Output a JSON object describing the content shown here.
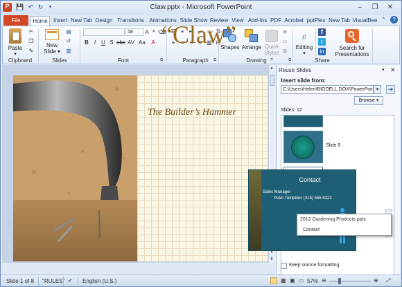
{
  "window": {
    "title": "Claw.pptx - Microsoft PowerPoint"
  },
  "qat": {
    "save_icon": "save-icon",
    "undo_icon": "undo-icon",
    "redo_icon": "redo-icon",
    "customize_icon": "chevron-down-icon"
  },
  "window_controls": {
    "minimize": "–",
    "restore": "❐",
    "close": "✕"
  },
  "tabs": [
    {
      "label": "File"
    },
    {
      "label": "Home"
    },
    {
      "label": "Insert"
    },
    {
      "label": "New Tab"
    },
    {
      "label": "Design"
    },
    {
      "label": "Transitions"
    },
    {
      "label": "Animations"
    },
    {
      "label": "Slide Show"
    },
    {
      "label": "Review"
    },
    {
      "label": "View"
    },
    {
      "label": "Add-Ins"
    },
    {
      "label": "PDF"
    },
    {
      "label": "Acrobat"
    },
    {
      "label": "pptPlex"
    },
    {
      "label": "New Tab"
    },
    {
      "label": "VisualBee"
    }
  ],
  "ribbon": {
    "groups": {
      "clipboard": "Clipboard",
      "slides": "Slides",
      "font": "Font",
      "paragraph": "Paragraph",
      "drawing": "Drawing",
      "editing": "",
      "share": "Share"
    },
    "paste_label": "Paste",
    "new_slide_label": "New",
    "new_slide_label2": "Slide ▾",
    "font_size": "18",
    "shapes_label": "Shapes",
    "arrange_label": "Arrange",
    "quick_styles_label": "Quick",
    "quick_styles_label2": "Styles ▾",
    "editing_label": "Editing",
    "search_label": "Search for",
    "search_label2": "Presentations"
  },
  "slide": {
    "title": "“Claw”",
    "subtitle": "The Builder’s Hammer"
  },
  "reuse_pane": {
    "title": "Reuse Slides",
    "insert_from_label": "Insert slide from:",
    "path_value": "C:\\Users\\Helen\\BIGDELL DOX\\PowerPoint",
    "browse_label": "Browse ▾",
    "slides_count": "Slides: 12",
    "thumbs": [
      {
        "label": ""
      },
      {
        "label": "Slide 9"
      },
      {
        "label": ""
      }
    ],
    "keep_formatting_label": "Keep source formatting"
  },
  "popup": {
    "title": "Contact",
    "line1": "Sales Manager",
    "line2": "Peter Tompkins (415) 555 6323"
  },
  "tooltip": {
    "file": "2012 Gardening Products.pptx",
    "slide_title": "Contact"
  },
  "status": {
    "slide_info": "Slide 1 of 8",
    "theme": "\"RULES\"",
    "language": "English (U.S.)",
    "zoom": "57%"
  },
  "colors": {
    "file_tab": "#d24726",
    "accent_blue": "#274f8c",
    "title_gold": "#9b6c1d"
  }
}
